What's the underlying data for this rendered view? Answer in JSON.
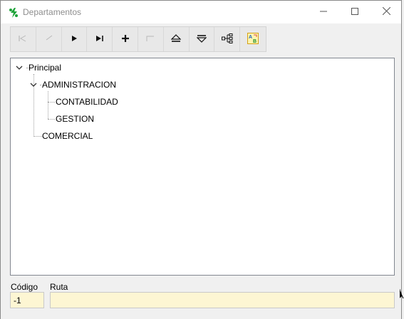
{
  "window": {
    "title": "Departamentos",
    "icon": "app-logo-icon",
    "controls": [
      "minimize-icon",
      "maximize-icon",
      "close-icon"
    ]
  },
  "toolbar": {
    "buttons": [
      {
        "name": "first-record-button",
        "icon": "first-icon",
        "enabled": false
      },
      {
        "name": "prev-record-button",
        "icon": "prev-icon",
        "enabled": false
      },
      {
        "name": "next-record-button",
        "icon": "next-icon",
        "enabled": true
      },
      {
        "name": "last-record-button",
        "icon": "last-icon",
        "enabled": true
      },
      {
        "name": "add-button",
        "icon": "plus-icon",
        "enabled": true
      },
      {
        "name": "edit-button",
        "icon": "edit-icon",
        "enabled": false
      },
      {
        "name": "expand-button",
        "icon": "eject-icon",
        "enabled": true
      },
      {
        "name": "collapse-button",
        "icon": "collapse-icon",
        "enabled": true
      },
      {
        "name": "tree-structure-button",
        "icon": "hierarchy-icon",
        "enabled": true
      },
      {
        "name": "rename-button",
        "icon": "rename-icon",
        "enabled": true
      }
    ]
  },
  "tree": {
    "nodes": [
      {
        "label": "Principal",
        "level": 0,
        "expanded": true
      },
      {
        "label": "ADMINISTRACION",
        "level": 1,
        "expanded": true
      },
      {
        "label": "CONTABILIDAD",
        "level": 2
      },
      {
        "label": "GESTION",
        "level": 2
      },
      {
        "label": "COMERCIAL",
        "level": 1
      }
    ]
  },
  "fields": {
    "codigo_label": "Código",
    "codigo_value": "-1",
    "ruta_label": "Ruta",
    "ruta_value": ""
  },
  "colors": {
    "field_bg": "#fdf6d3",
    "accent_green": "#1fa33a"
  }
}
